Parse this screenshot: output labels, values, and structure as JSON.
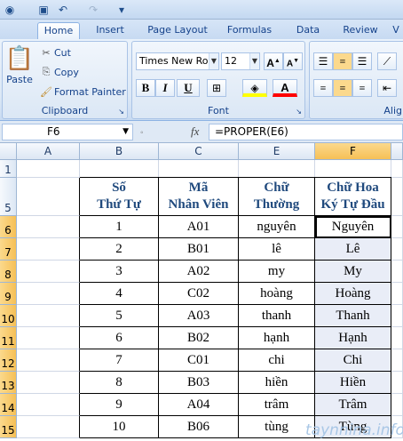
{
  "ribbon": {
    "tabs": [
      "Home",
      "Insert",
      "Page Layout",
      "Formulas",
      "Data",
      "Review"
    ],
    "clipboard": {
      "paste": "Paste",
      "cut": "Cut",
      "copy": "Copy",
      "format_painter": "Format Painter",
      "label": "Clipboard"
    },
    "font": {
      "name": "Times New Rom",
      "size": "12",
      "label": "Font"
    },
    "alignment_label": "Alig"
  },
  "formula_bar": {
    "cell_ref": "F6",
    "fx": "fx",
    "formula": "=PROPER(E6)"
  },
  "columns": [
    "A",
    "B",
    "C",
    "E",
    "F"
  ],
  "rows": [
    "1",
    "5",
    "6",
    "7",
    "8",
    "9",
    "10",
    "11",
    "12",
    "13",
    "14",
    "15"
  ],
  "table": {
    "headers": [
      [
        "Số",
        "Thứ Tự"
      ],
      [
        "Mã",
        "Nhân Viên"
      ],
      [
        "Chữ",
        "Thường"
      ],
      [
        "Chữ Hoa",
        "Ký Tự Đầu"
      ]
    ],
    "rows": [
      [
        "1",
        "A01",
        "nguyên",
        "Nguyên"
      ],
      [
        "2",
        "B01",
        "lê",
        "Lê"
      ],
      [
        "3",
        "A02",
        "my",
        "My"
      ],
      [
        "4",
        "C02",
        "hoàng",
        "Hoàng"
      ],
      [
        "5",
        "A03",
        "thanh",
        "Thanh"
      ],
      [
        "6",
        "B02",
        "hạnh",
        "Hạnh"
      ],
      [
        "7",
        "C01",
        "chi",
        "Chi"
      ],
      [
        "8",
        "B03",
        "hiền",
        "Hiền"
      ],
      [
        "9",
        "A04",
        "trâm",
        "Trâm"
      ],
      [
        "10",
        "B06",
        "tùng",
        "Tùng"
      ]
    ]
  },
  "watermark": "taynnina.info"
}
